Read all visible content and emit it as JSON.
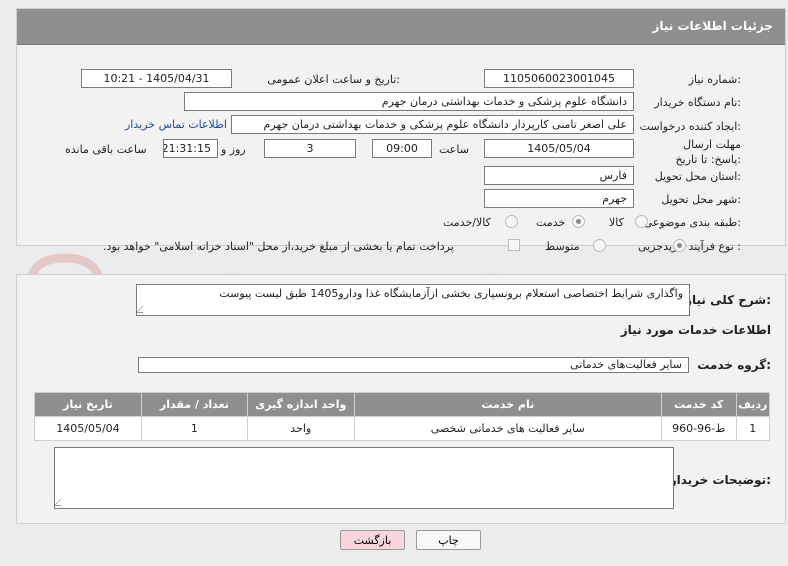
{
  "header": {
    "title": "جزئیات اطلاعات نیاز"
  },
  "need_number": {
    "label": "شماره نیاز:",
    "value": "1105060023001045"
  },
  "announce": {
    "label": "تاریخ و ساعت اعلان عمومی:",
    "value": "1405/04/31 - 10:21"
  },
  "buyer_org": {
    "label": "نام دستگاه خریدار:",
    "value": "دانشگاه علوم پزشکی و خدمات بهداشتی  درمان جهرم"
  },
  "requester": {
    "label": "ایجاد کننده درخواست:",
    "value": "علی اصغر  تامنی کارپرداز  دانشگاه علوم پزشکی و خدمات بهداشتی  درمان جهرم",
    "contact_link": "اطلاعات تماس خریدار"
  },
  "deadline": {
    "label": "مهلت ارسال پاسخ: تا تاریخ:",
    "date": "1405/05/04",
    "time_label": "ساعت",
    "time": "09:00",
    "days": "3",
    "days_label": "روز و",
    "remaining": "21:31:15",
    "remaining_label": "ساعت باقی مانده"
  },
  "province": {
    "label": "استان محل تحویل:",
    "value": "فارس"
  },
  "city": {
    "label": "شهر محل تحویل:",
    "value": "جهرم"
  },
  "category": {
    "label": "طبقه بندی موضوعی:",
    "options": [
      "کالا",
      "خدمت",
      "کالا/خدمت"
    ],
    "selected": "خدمت"
  },
  "process": {
    "label": "نوع فرآیند خرید :",
    "options": [
      "جزیی",
      "متوسط"
    ],
    "selected": "جزیی",
    "payment_note": "پرداخت تمام یا بخشی از مبلغ خرید،از محل \"اسناد خزانه اسلامی\" خواهد بود."
  },
  "description": {
    "label": "شرح کلی نیاز:",
    "value": "واگذاری شرایط اختصاصی استعلام برونسپاری بخشی ازآزمایشگاه غذا ودارو1405 طبق لیست پیوست"
  },
  "services_title": "اطلاعات خدمات مورد نیاز",
  "service_group": {
    "label": "گروه خدمت:",
    "value": "سایر فعالیت‌های خدماتی"
  },
  "table": {
    "headers": [
      "ردیف",
      "کد خدمت",
      "نام خدمت",
      "واحد اندازه گیری",
      "تعداد / مقدار",
      "تاریخ نیاز"
    ],
    "rows": [
      [
        "1",
        "ط-96-960",
        "سایر فعالیت های خدماتی شخصی",
        "واحد",
        "1",
        "1405/05/04"
      ]
    ]
  },
  "buyer_notes": {
    "label": "توضیحات خریدار:",
    "value": ""
  },
  "buttons": {
    "print": "چاپ",
    "back": "بازگشت"
  },
  "watermark": "AriaTender.net"
}
